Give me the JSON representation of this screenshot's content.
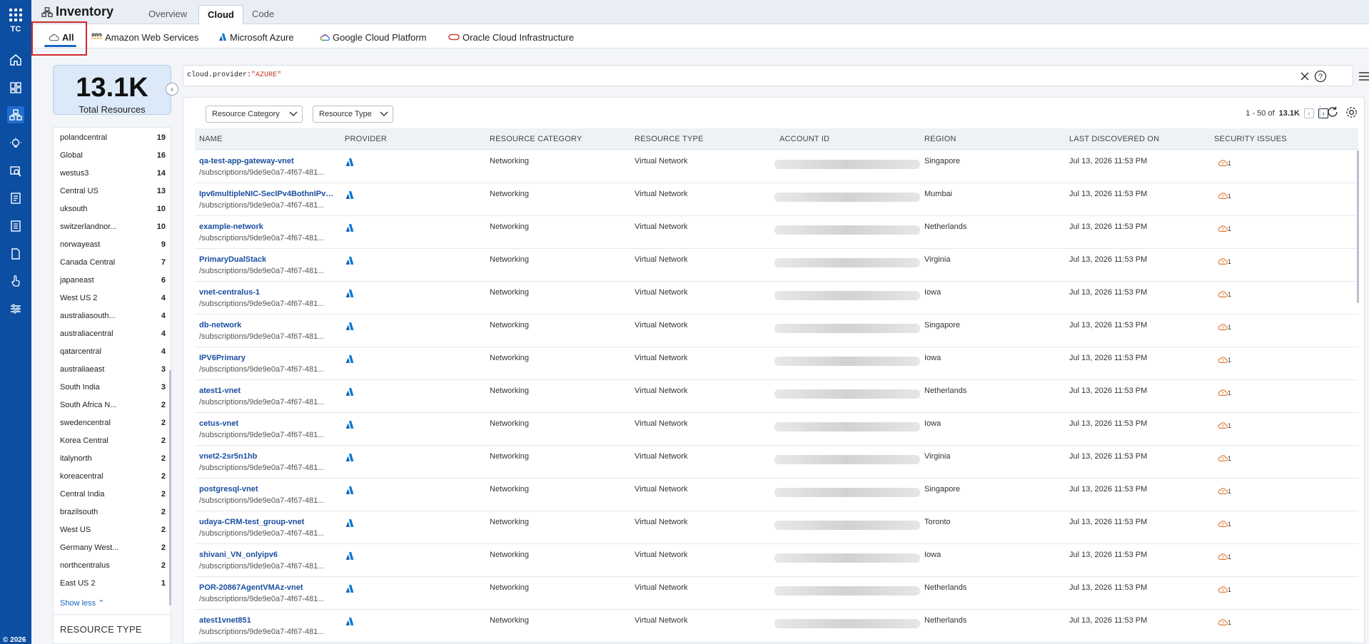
{
  "rail": {
    "initials": "TC",
    "copyright": "© 2026"
  },
  "header": {
    "title": "Inventory",
    "tabs": [
      {
        "label": "Overview"
      },
      {
        "label": "Cloud"
      },
      {
        "label": "Code"
      }
    ]
  },
  "provider_tabs": [
    {
      "label": "All"
    },
    {
      "label": "Amazon Web Services",
      "logo": "aws"
    },
    {
      "label": "Microsoft Azure"
    },
    {
      "label": "Google Cloud Platform"
    },
    {
      "label": "Oracle Cloud Infrastructure"
    }
  ],
  "summary": {
    "count": "13.1K",
    "label": "Total Resources"
  },
  "search": {
    "key": "cloud.provider:",
    "value": "\"AZURE\""
  },
  "region_filter": {
    "items": [
      {
        "name": "polandcentral",
        "count": "19"
      },
      {
        "name": "Global",
        "count": "16"
      },
      {
        "name": "westus3",
        "count": "14"
      },
      {
        "name": "Central US",
        "count": "13"
      },
      {
        "name": "uksouth",
        "count": "10"
      },
      {
        "name": "switzerlandnor...",
        "count": "10"
      },
      {
        "name": "norwayeast",
        "count": "9"
      },
      {
        "name": "Canada Central",
        "count": "7"
      },
      {
        "name": "japaneast",
        "count": "6"
      },
      {
        "name": "West US 2",
        "count": "4"
      },
      {
        "name": "australiasouth...",
        "count": "4"
      },
      {
        "name": "australiacentral",
        "count": "4"
      },
      {
        "name": "qatarcentral",
        "count": "4"
      },
      {
        "name": "australiaeast",
        "count": "3"
      },
      {
        "name": "South India",
        "count": "3"
      },
      {
        "name": "South Africa N...",
        "count": "2"
      },
      {
        "name": "swedencentral",
        "count": "2"
      },
      {
        "name": "Korea Central",
        "count": "2"
      },
      {
        "name": "italynorth",
        "count": "2"
      },
      {
        "name": "koreacentral",
        "count": "2"
      },
      {
        "name": "Central India",
        "count": "2"
      },
      {
        "name": "brazilsouth",
        "count": "2"
      },
      {
        "name": "West US",
        "count": "2"
      },
      {
        "name": "Germany West...",
        "count": "2"
      },
      {
        "name": "northcentralus",
        "count": "2"
      },
      {
        "name": "East US 2",
        "count": "1"
      }
    ],
    "show_less": "Show less",
    "next_section": "RESOURCE TYPE"
  },
  "toolbar": {
    "resource_category": "Resource Category",
    "resource_type": "Resource Type",
    "range": "1 - 50 of",
    "total": "13.1K"
  },
  "table": {
    "columns": [
      "NAME",
      "PROVIDER",
      "RESOURCE CATEGORY",
      "RESOURCE TYPE",
      "ACCOUNT ID",
      "REGION",
      "LAST DISCOVERED ON",
      "SECURITY ISSUES"
    ],
    "rows": [
      {
        "name": "qa-test-app-gateway-vnet",
        "path": "/subscriptions/9de9e0a7-4f67-481...",
        "category": "Networking",
        "type": "Virtual Network",
        "region": "Singapore",
        "discovered": "Jul 13, 2026 11:53 PM",
        "issues": "1"
      },
      {
        "name": "Ipv6multipleNIC-SecIPv4BothnIPv6...",
        "path": "/subscriptions/9de9e0a7-4f67-481...",
        "category": "Networking",
        "type": "Virtual Network",
        "region": "Mumbai",
        "discovered": "Jul 13, 2026 11:53 PM",
        "issues": "1"
      },
      {
        "name": "example-network",
        "path": "/subscriptions/9de9e0a7-4f67-481...",
        "category": "Networking",
        "type": "Virtual Network",
        "region": "Netherlands",
        "discovered": "Jul 13, 2026 11:53 PM",
        "issues": "1"
      },
      {
        "name": "PrimaryDualStack",
        "path": "/subscriptions/9de9e0a7-4f67-481...",
        "category": "Networking",
        "type": "Virtual Network",
        "region": "Virginia",
        "discovered": "Jul 13, 2026 11:53 PM",
        "issues": "1"
      },
      {
        "name": "vnet-centralus-1",
        "path": "/subscriptions/9de9e0a7-4f67-481...",
        "category": "Networking",
        "type": "Virtual Network",
        "region": "Iowa",
        "discovered": "Jul 13, 2026 11:53 PM",
        "issues": "1"
      },
      {
        "name": "db-network",
        "path": "/subscriptions/9de9e0a7-4f67-481...",
        "category": "Networking",
        "type": "Virtual Network",
        "region": "Singapore",
        "discovered": "Jul 13, 2026 11:53 PM",
        "issues": "1"
      },
      {
        "name": "IPV6Primary",
        "path": "/subscriptions/9de9e0a7-4f67-481...",
        "category": "Networking",
        "type": "Virtual Network",
        "region": "Iowa",
        "discovered": "Jul 13, 2026 11:53 PM",
        "issues": "1"
      },
      {
        "name": "atest1-vnet",
        "path": "/subscriptions/9de9e0a7-4f67-481...",
        "category": "Networking",
        "type": "Virtual Network",
        "region": "Netherlands",
        "discovered": "Jul 13, 2026 11:53 PM",
        "issues": "1"
      },
      {
        "name": "cetus-vnet",
        "path": "/subscriptions/9de9e0a7-4f67-481...",
        "category": "Networking",
        "type": "Virtual Network",
        "region": "Iowa",
        "discovered": "Jul 13, 2026 11:53 PM",
        "issues": "1"
      },
      {
        "name": "vnet2-2sr5n1hb",
        "path": "/subscriptions/9de9e0a7-4f67-481...",
        "category": "Networking",
        "type": "Virtual Network",
        "region": "Virginia",
        "discovered": "Jul 13, 2026 11:53 PM",
        "issues": "1"
      },
      {
        "name": "postgresql-vnet",
        "path": "/subscriptions/9de9e0a7-4f67-481...",
        "category": "Networking",
        "type": "Virtual Network",
        "region": "Singapore",
        "discovered": "Jul 13, 2026 11:53 PM",
        "issues": "1"
      },
      {
        "name": "udaya-CRM-test_group-vnet",
        "path": "/subscriptions/9de9e0a7-4f67-481...",
        "category": "Networking",
        "type": "Virtual Network",
        "region": "Toronto",
        "discovered": "Jul 13, 2026 11:53 PM",
        "issues": "1"
      },
      {
        "name": "shivani_VN_onlyipv6",
        "path": "/subscriptions/9de9e0a7-4f67-481...",
        "category": "Networking",
        "type": "Virtual Network",
        "region": "Iowa",
        "discovered": "Jul 13, 2026 11:53 PM",
        "issues": "1"
      },
      {
        "name": "POR-20867AgentVMAz-vnet",
        "path": "/subscriptions/9de9e0a7-4f67-481...",
        "category": "Networking",
        "type": "Virtual Network",
        "region": "Netherlands",
        "discovered": "Jul 13, 2026 11:53 PM",
        "issues": "1"
      },
      {
        "name": "atest1vnet851",
        "path": "/subscriptions/9de9e0a7-4f67-481...",
        "category": "Networking",
        "type": "Virtual Network",
        "region": "Netherlands",
        "discovered": "Jul 13, 2026 11:53 PM",
        "issues": "1"
      }
    ]
  },
  "colors": {
    "rail": "#0b4ea2",
    "accent": "#1a67c4",
    "link": "#1a4fa0",
    "azure": "#0078d4",
    "issue": "#e07a2e",
    "highlight": "#d32a2a"
  }
}
